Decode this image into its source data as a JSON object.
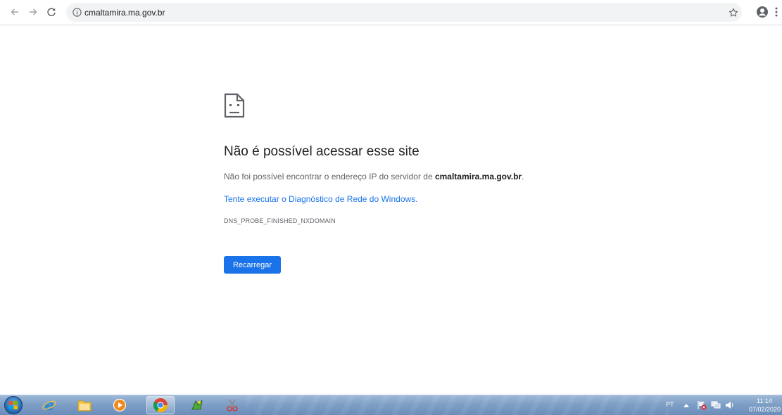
{
  "browser": {
    "url": "cmaltamira.ma.gov.br",
    "icons": {
      "back": "arrow-left-icon",
      "forward": "arrow-right-icon",
      "reload": "reload-icon",
      "info": "info-icon",
      "star": "star-icon",
      "profile": "account-icon",
      "menu": "kebab-menu-icon"
    }
  },
  "error": {
    "icon": "sad-page-icon",
    "title": "Não é possível acessar esse site",
    "desc_prefix": "Não foi possível encontrar o endereço IP do servidor de ",
    "desc_domain": "cmaltamira.ma.gov.br",
    "desc_suffix": ".",
    "diagnostic_link": "Tente executar o Diagnóstico de Rede do Windows.",
    "error_code": "DNS_PROBE_FINISHED_NXDOMAIN",
    "reload_button": "Recarregar"
  },
  "taskbar": {
    "apps": [
      {
        "name": "internet-explorer",
        "icon": "internet-explorer-icon"
      },
      {
        "name": "file-explorer",
        "icon": "folder-icon"
      },
      {
        "name": "media-player",
        "icon": "media-player-icon"
      },
      {
        "name": "chrome",
        "icon": "chrome-icon",
        "active": true
      },
      {
        "name": "map-app",
        "icon": "map-icon"
      },
      {
        "name": "snipping-tool",
        "icon": "scissors-icon"
      }
    ],
    "language": "PT",
    "time": "11:14",
    "date": "07/02/2020"
  },
  "colors": {
    "accent": "#1a73e8",
    "text_primary": "#202124",
    "text_secondary": "#5f6368",
    "taskbar": "#7e9fc6"
  }
}
